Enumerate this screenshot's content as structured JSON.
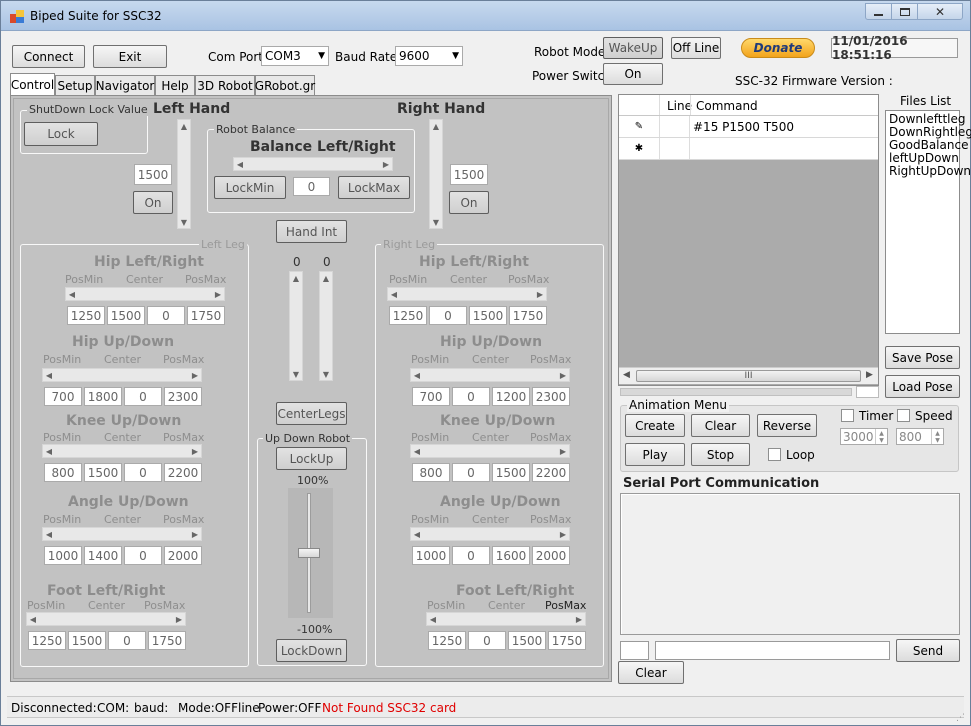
{
  "window": {
    "title": "Biped Suite for SSC32"
  },
  "top": {
    "connect": "Connect",
    "exit": "Exit",
    "com_port_label": "Com Port:",
    "com_port": "COM3",
    "baud_label": "Baud Rate:",
    "baud": "9600",
    "robot_mode_label": "Robot Mode",
    "wakeup": "WakeUp",
    "offline": "Off Line",
    "power_switch_label": "Power Switch",
    "power_on": "On",
    "donate": "Donate",
    "datetime": "11/01/2016 18:51:16",
    "firmware_label": "SSC-32 Firmware Version :"
  },
  "tabs": [
    "Control",
    "Setup",
    "Navigator",
    "Help",
    "3D Robot",
    "GRobot.gr"
  ],
  "control": {
    "shutdown_group": "ShutDown Lock Value",
    "lock": "Lock",
    "left_hand": "Left Hand",
    "right_hand": "Right Hand",
    "robot_balance_group": "Robot Balance",
    "balance_title": "Balance Left/Right",
    "lockmin": "LockMin",
    "lockmax": "LockMax",
    "balance_value": "0",
    "left_hand_value": "1500",
    "right_hand_value": "1500",
    "left_hand_on": "On",
    "right_hand_on": "On",
    "hand_int": "Hand Int",
    "left_leg_group": "Left Leg",
    "right_leg_group": "Right Leg",
    "mid_values": [
      "0",
      "0"
    ],
    "center_legs": "CenterLegs",
    "updown_group": "Up Down Robot",
    "lockup": "LockUp",
    "lockdown": "LockDown",
    "pct_top": "100%",
    "pct_bottom": "-100%",
    "left_leg": [
      {
        "title": "Hip Left/Right",
        "vals": [
          "1250",
          "1500",
          "0",
          "1750"
        ]
      },
      {
        "title": "Hip Up/Down",
        "vals": [
          "700",
          "1800",
          "0",
          "2300"
        ]
      },
      {
        "title": "Knee Up/Down",
        "vals": [
          "800",
          "1500",
          "0",
          "2200"
        ]
      },
      {
        "title": "Angle Up/Down",
        "vals": [
          "1000",
          "1400",
          "0",
          "2000"
        ]
      },
      {
        "title": "Foot Left/Right",
        "vals": [
          "1250",
          "1500",
          "0",
          "1750"
        ]
      }
    ],
    "right_leg": [
      {
        "title": "Hip Left/Right",
        "vals": [
          "1250",
          "0",
          "1500",
          "1750"
        ]
      },
      {
        "title": "Hip Up/Down",
        "vals": [
          "700",
          "0",
          "1200",
          "2300"
        ]
      },
      {
        "title": "Knee Up/Down",
        "vals": [
          "800",
          "0",
          "1500",
          "2200"
        ]
      },
      {
        "title": "Angle Up/Down",
        "vals": [
          "1000",
          "0",
          "1600",
          "2000"
        ]
      },
      {
        "title": "Foot Left/Right",
        "vals": [
          "1250",
          "0",
          "1500",
          "1750"
        ]
      }
    ],
    "posmin": "PosMin",
    "center": "Center",
    "posmax": "PosMax"
  },
  "grid": {
    "col_line": "Line",
    "col_command": "Command",
    "rows": [
      {
        "command": "#15 P1500 T500"
      },
      {
        "command": ""
      }
    ],
    "scroll_mark": "III"
  },
  "files": {
    "label": "Files List",
    "items": [
      "Downlefttleg",
      "DownRightleg",
      "GoodBalance",
      "leftUpDown",
      "RightUpDown"
    ],
    "save_pose": "Save Pose",
    "load_pose": "Load Pose"
  },
  "animation": {
    "group": "Animation Menu",
    "create": "Create",
    "clear": "Clear",
    "reverse": "Reverse",
    "play": "Play",
    "stop": "Stop",
    "loop": "Loop",
    "timer": "Timer",
    "speed": "Speed",
    "timer_value": "3000",
    "speed_value": "800"
  },
  "serial": {
    "title": "Serial Port Communication",
    "send": "Send",
    "clear": "Clear"
  },
  "status": {
    "disconnected": "Disconnected:",
    "com": "COM:",
    "baud": "baud:",
    "mode": "Mode:OFFline",
    "power": "Power:OFF",
    "error": "Not Found SSC32 card",
    "error_color": "#e00000"
  }
}
